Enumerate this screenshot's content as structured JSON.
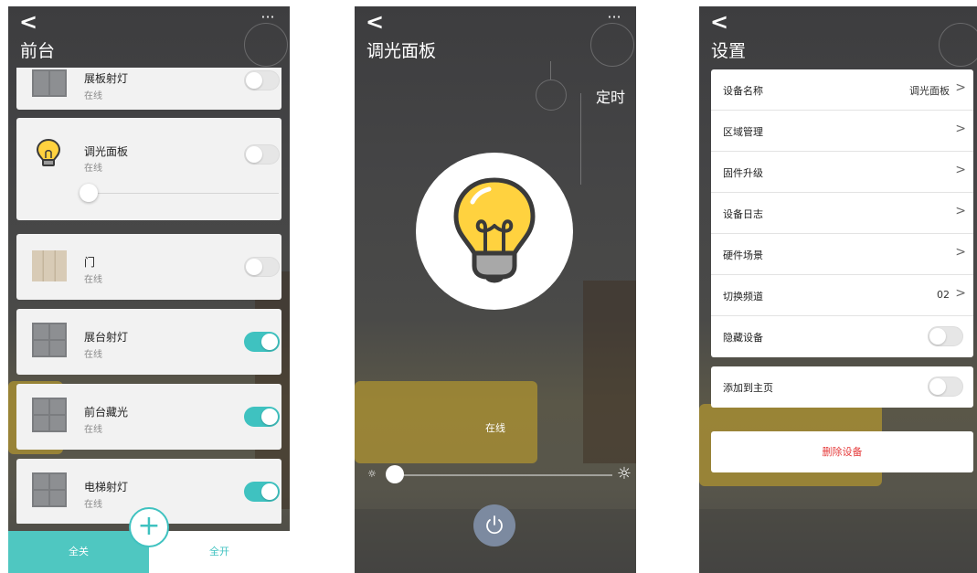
{
  "screen1": {
    "title": "前台",
    "devices": [
      {
        "name": "展板射灯",
        "status": "在线",
        "toggle_on": false,
        "thumb": "switch"
      },
      {
        "name": "调光面板",
        "status": "在线",
        "toggle_on": false,
        "thumb": "bulb",
        "brightness": 0.0
      },
      {
        "name": "门",
        "status": "在线",
        "toggle_on": false,
        "thumb": "door"
      },
      {
        "name": "展台射灯",
        "status": "在线",
        "toggle_on": true,
        "thumb": "switch"
      },
      {
        "name": "前台藏光",
        "status": "在线",
        "toggle_on": true,
        "thumb": "switch"
      },
      {
        "name": "电梯射灯",
        "status": "在线",
        "toggle_on": true,
        "thumb": "switch"
      }
    ],
    "all_off_label": "全关",
    "all_on_label": "全开",
    "add_symbol": "+"
  },
  "screen2": {
    "title": "调光面板",
    "timer_label": "定时",
    "status": "在线",
    "brightness": 0.0
  },
  "screen3": {
    "title": "设置",
    "rows": [
      {
        "label": "设备名称",
        "value": "调光面板"
      },
      {
        "label": "区域管理",
        "value": ""
      },
      {
        "label": "固件升级",
        "value": ""
      },
      {
        "label": "设备日志",
        "value": ""
      },
      {
        "label": "硬件场景",
        "value": ""
      },
      {
        "label": "切换频道",
        "value": "02"
      }
    ],
    "hide_device_label": "隐藏设备",
    "add_home_label": "添加到主页",
    "delete_label": "删除设备"
  },
  "icons": {
    "back": "‹",
    "more": "···",
    "chevron": "›"
  },
  "colors": {
    "accent": "#3fc2c0",
    "danger": "#e53a3a",
    "power": "#7c8aa0"
  }
}
